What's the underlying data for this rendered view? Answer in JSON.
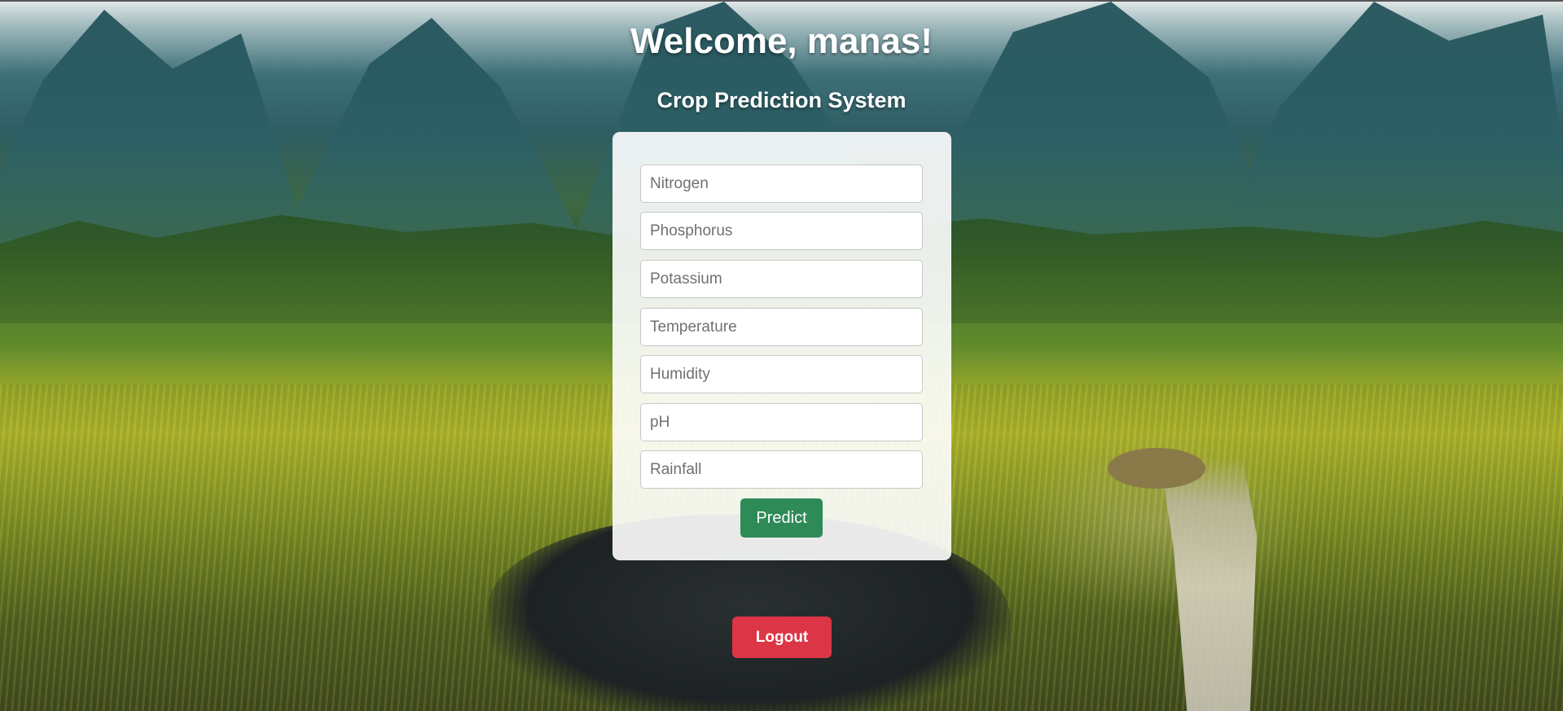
{
  "header": {
    "welcome": "Welcome, manas!",
    "subtitle": "Crop Prediction System"
  },
  "form": {
    "fields": [
      {
        "placeholder": "Nitrogen",
        "value": ""
      },
      {
        "placeholder": "Phosphorus",
        "value": ""
      },
      {
        "placeholder": "Potassium",
        "value": ""
      },
      {
        "placeholder": "Temperature",
        "value": ""
      },
      {
        "placeholder": "Humidity",
        "value": ""
      },
      {
        "placeholder": "pH",
        "value": ""
      },
      {
        "placeholder": "Rainfall",
        "value": ""
      }
    ],
    "submit_label": "Predict"
  },
  "logout_label": "Logout",
  "colors": {
    "predict_button": "#2e8b57",
    "logout_button": "#dc3545",
    "card_background": "#ffffff"
  }
}
